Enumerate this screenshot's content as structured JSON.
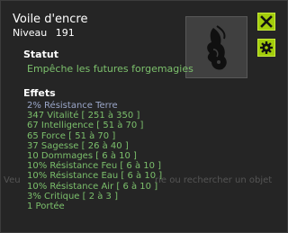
{
  "colors": {
    "panel_bg": "#252525",
    "accent_green": "#a3cd0c",
    "positive_effect": "#7cc06c",
    "first_effect": "#9aa6c8",
    "white_text": "#ffffff"
  },
  "item": {
    "name": "Voile d'encre",
    "level_label": "Niveau",
    "level_value": "191",
    "image_icon": "ink-veil-icon"
  },
  "buttons": {
    "close_icon": "close-x-icon",
    "settings_icon": "gear-icon"
  },
  "statut": {
    "label": "Statut",
    "text": "Empêche les futures forgemagies"
  },
  "effets": {
    "label": "Effets",
    "items": [
      "2% Résistance Terre",
      "347 Vitalité  [ 251 à 350 ]",
      "67 Intelligence  [ 51 à 70 ]",
      "65 Force  [ 51 à 70 ]",
      "37 Sagesse  [ 26 à 40 ]",
      "10 Dommages  [ 6 à 10 ]",
      "10% Résistance Feu  [ 6 à 10 ]",
      "10% Résistance Eau  [ 6 à 10 ]",
      "10% Résistance Air  [ 6 à 10 ]",
      "3% Critique  [ 2 à 3 ]",
      "1 Portée"
    ]
  },
  "background_hint": {
    "left": "Veu",
    "right": "rie ou rechercher un objet"
  }
}
